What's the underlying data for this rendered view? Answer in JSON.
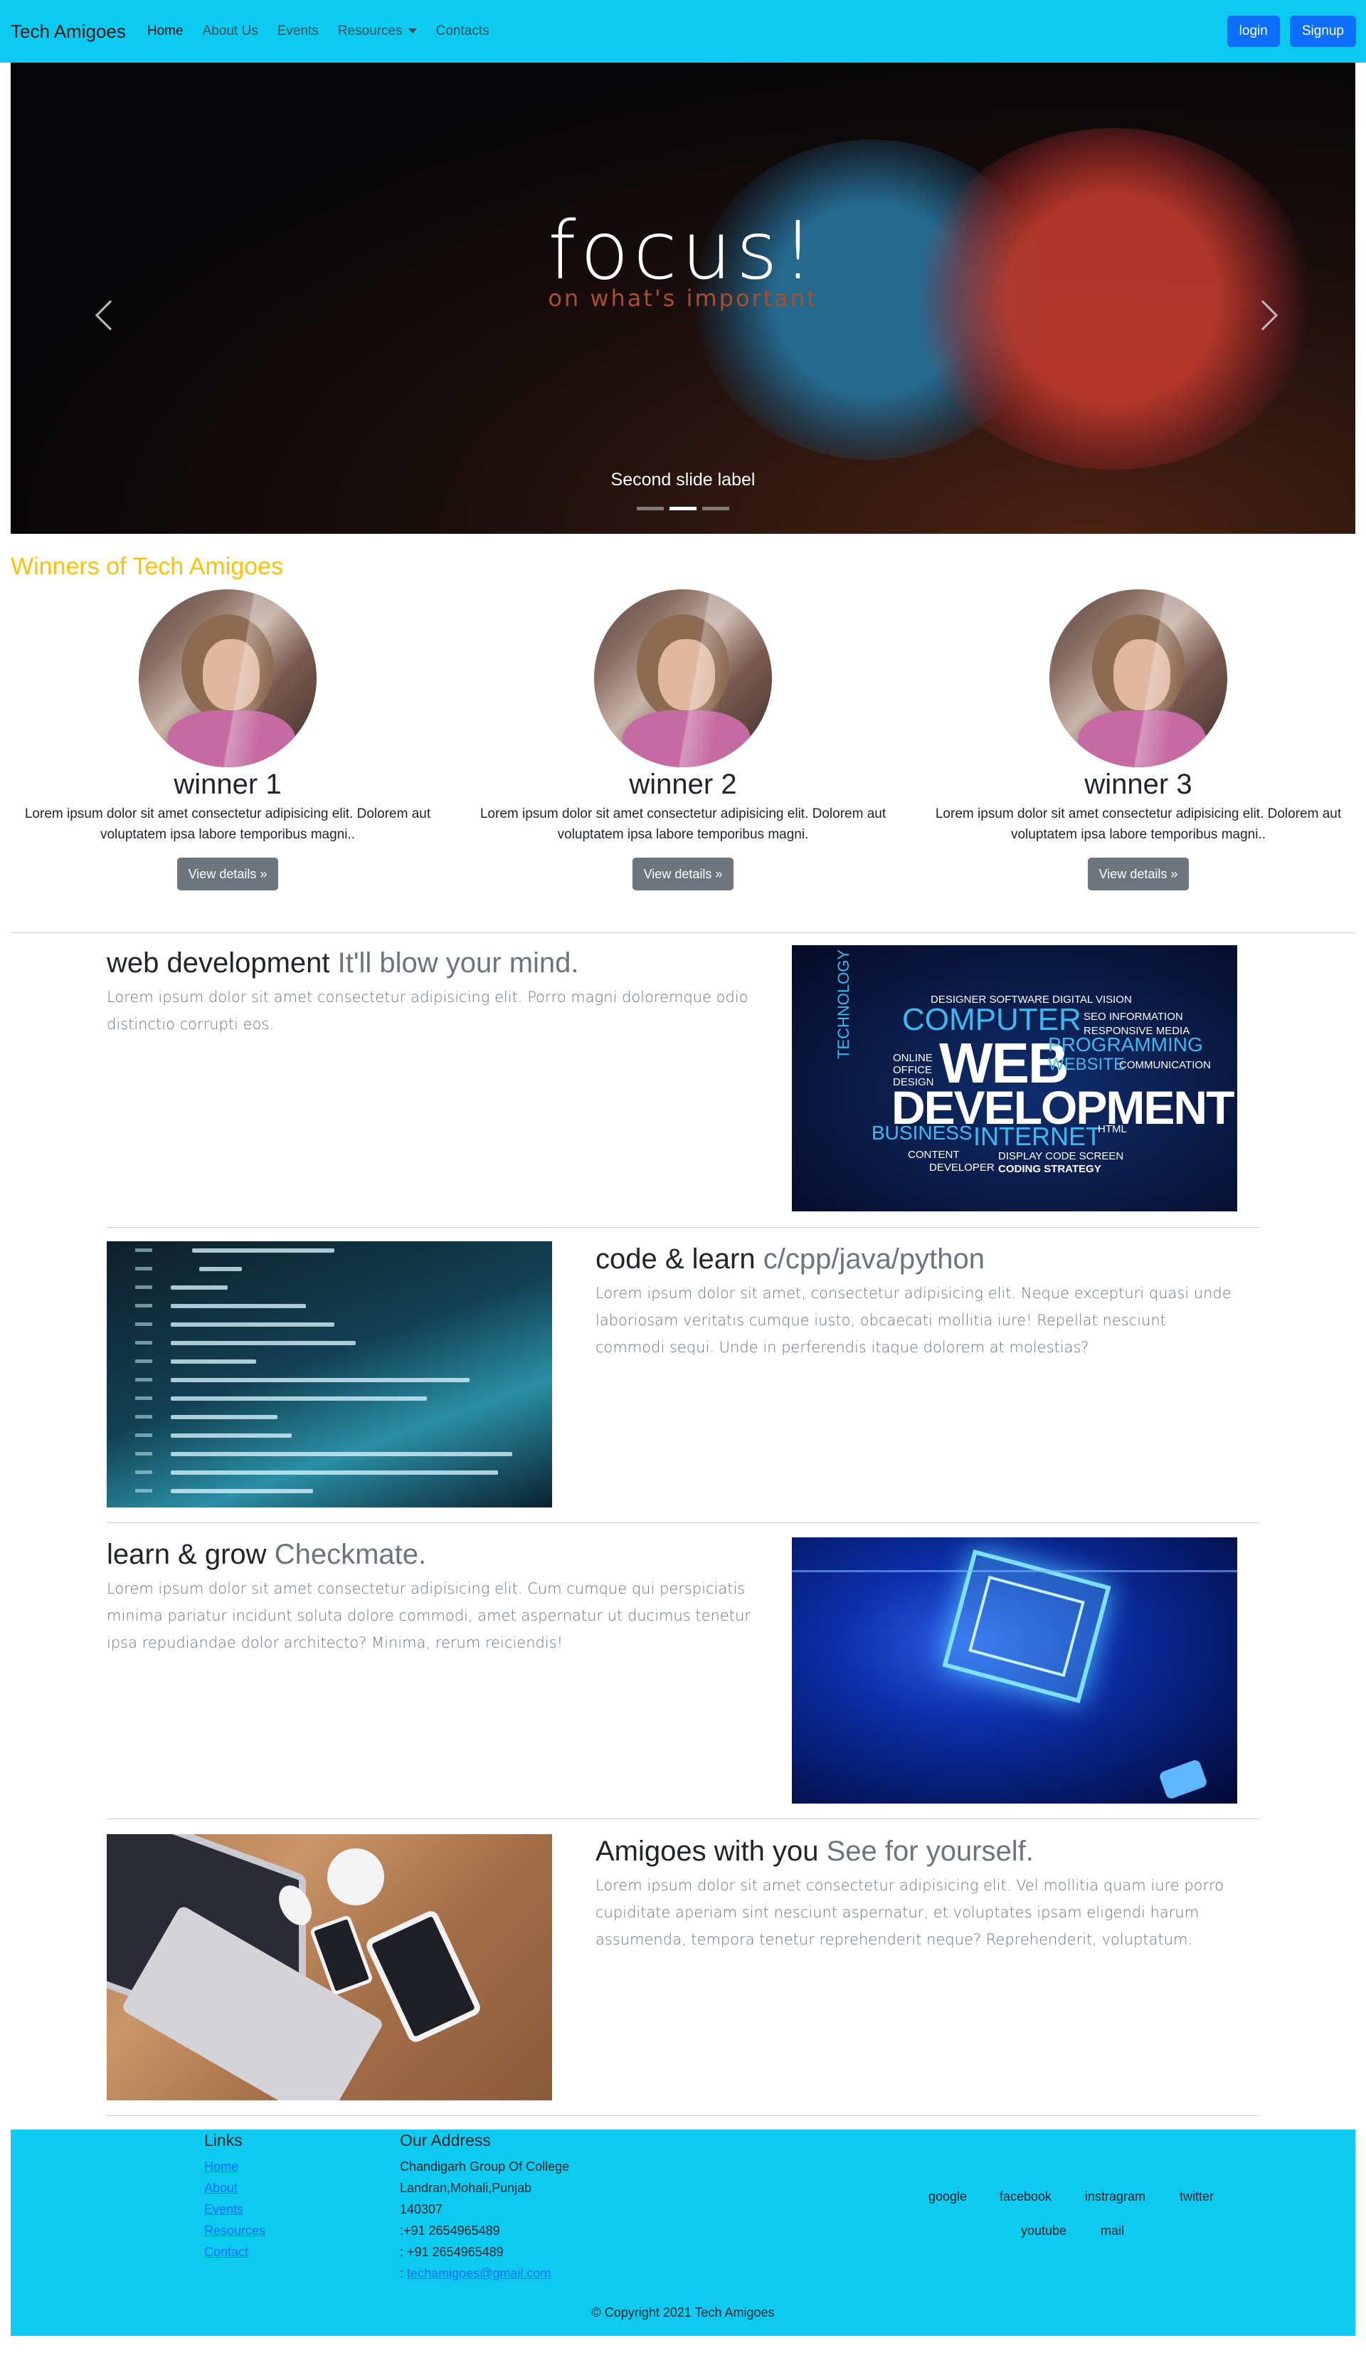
{
  "navbar": {
    "brand": "Tech Amigoes",
    "links": [
      "Home",
      "About Us",
      "Events",
      "Resources",
      "Contacts"
    ],
    "login": "login",
    "signup": "Signup"
  },
  "carousel": {
    "headline": "focus!",
    "subline": "on what's important",
    "caption": "Second slide label",
    "active_slide": 2,
    "slide_count": 3
  },
  "winners": {
    "title": "Winners of Tech Amigoes",
    "items": [
      {
        "name": "winner 1",
        "text": "Lorem ipsum dolor sit amet consectetur adipisicing elit. Dolorem aut voluptatem ipsa labore temporibus magni..",
        "button": "View details »"
      },
      {
        "name": "winner 2",
        "text": "Lorem ipsum dolor sit amet consectetur adipisicing elit. Dolorem aut voluptatem ipsa labore temporibus magni.",
        "button": "View details »"
      },
      {
        "name": "winner 3",
        "text": "Lorem ipsum dolor sit amet consectetur adipisicing elit. Dolorem aut voluptatem ipsa labore temporibus magni..",
        "button": "View details »"
      }
    ]
  },
  "featurettes": [
    {
      "heading": "web development",
      "muted": "It'll blow your mind.",
      "text": "Lorem ipsum dolor sit amet consectetur adipisicing elit. Porro magni doloremque odio distinctio corrupti eos."
    },
    {
      "heading": "code & learn",
      "muted": "c/cpp/java/python",
      "text": "Lorem ipsum dolor sit amet, consectetur adipisicing elit. Neque excepturi quasi unde laboriosam veritatis cumque iusto, obcaecati mollitia iure! Repellat nesciunt commodi sequi. Unde in perferendis itaque dolorem at molestias?"
    },
    {
      "heading": "learn & grow",
      "muted": "Checkmate.",
      "text": "Lorem ipsum dolor sit amet consectetur adipisicing elit. Cum cumque qui perspiciatis minima pariatur incidunt soluta dolore commodi, amet aspernatur ut ducimus tenetur ipsa repudiandae dolor architecto? Minima, rerum reiciendis!"
    },
    {
      "heading": "Amigoes with you",
      "muted": "See for yourself.",
      "text": "Lorem ipsum dolor sit amet consectetur adipisicing elit. Vel mollitia quam iure porro cupiditate aperiam sint nesciunt aspernatur, et voluptates ipsam eligendi harum assumenda, tempora tenetur reprehenderit neque? Reprehenderit, voluptatum."
    }
  ],
  "webdev_image_words": {
    "big1": "WEB",
    "big2": "DEVELOPMENT",
    "computer": "COMPUTER",
    "internet": "INTERNET",
    "business": "BUSINESS",
    "programming": "PROGRAMMING",
    "website": "WEBSITE",
    "technology": "TECHNOLOGY",
    "small1": "DESIGNER  SOFTWARE DIGITAL  VISION",
    "small2": "SEO  INFORMATION",
    "small3": "RESPONSIVE  MEDIA",
    "small4": "COMMUNICATION",
    "small5": "DISPLAY  CODE  SCREEN",
    "small6": "CODING  STRATEGY",
    "small7": "CONTENT",
    "small8": "DEVELOPER",
    "small9": "ONLINE  OFFICE  DESIGN",
    "small10": "HTML"
  },
  "footer": {
    "links_title": "Links",
    "links": [
      "Home",
      "About",
      "Events",
      "Resources",
      "Contact"
    ],
    "address_title": "Our Address",
    "address_lines": [
      "Chandigarh Group Of College",
      "Landran,Mohali,Punjab",
      "140307",
      ":+91 2654965489",
      ": +91 2654965489"
    ],
    "email_prefix": ": ",
    "email": "techamigoes@gmail.com",
    "social": [
      "google",
      "facebook",
      "instragram",
      "twitter",
      "youtube",
      "mail"
    ],
    "copyright": "© Copyright 2021 Tech Amigoes"
  },
  "colors": {
    "navbar": "#0dcaf0",
    "primary_button": "#0d6efd",
    "winners_title": "#ffc107",
    "secondary_button": "#6c757d"
  }
}
